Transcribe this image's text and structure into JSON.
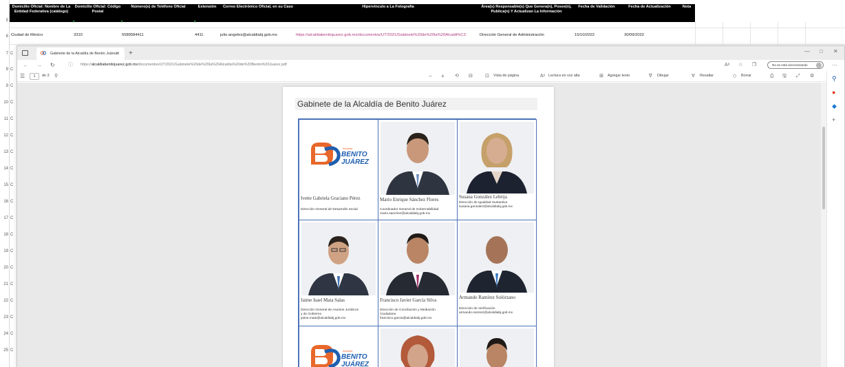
{
  "spreadsheet": {
    "header_cells": [
      "Domicilio Oficial: Nombre de La Entidad Federativa (catálogo)",
      "Domicilio Oficial: Código Postal",
      "Número(s) de Teléfono Oficial",
      "Extensión",
      "Correo Electrónico Oficial, en su Caso",
      "Hipervínculo a La Fotografía",
      "Área(s) Responsable(s) Que Genera(n), Posee(n), Publica(n) Y Actualizan La Información",
      "Fecha de Validación",
      "Fecha de Actualización",
      "Nota"
    ],
    "row6": {
      "entidad": "Ciudad de México",
      "cp": "3310",
      "telefono": "5589584411",
      "extension": "4411",
      "correo": "julio.angeles@alcaldiabj.gob.mx",
      "hipervinculo": "https://alcaldiabenitojuarez.gob.mx/documentos/UT/2021/Gabinete%20de%20la%20Alcaldi%C3",
      "area": "Dirección General de Administración",
      "fecha_validacion": "15/10/2022",
      "fecha_actualizacion": "30/09/2022"
    },
    "row_numbers": [
      "5",
      "6",
      "7",
      "8",
      "9",
      "10",
      "11",
      "12",
      "13",
      "14",
      "15",
      "16",
      "17",
      "18",
      "19",
      "20",
      "21",
      "22",
      "23",
      "24",
      "25"
    ],
    "col_letter": "C"
  },
  "browser": {
    "tab_title": "Gabinete de la Alcaldía de Benito Juárez",
    "tab_close": "×",
    "new_tab": "+",
    "url_prefix": "https://",
    "url_host": "alcaldiabenitojuarez.gob.mx",
    "url_path": "/documentos/UT/2021/Gabinete%20de%20la%20Alcaldia%20de%20Benito%20Juarez.pdf",
    "sync_label": "No se está sincronizando",
    "window_controls": [
      "—",
      "□",
      "✕"
    ]
  },
  "pdf_toolbar": {
    "page_current": "1",
    "page_total": "de 3",
    "page_view": "Vista de página",
    "read_aloud": "Lectura en voz alta",
    "add_text": "Agregar texto",
    "draw": "Dibujar",
    "highlight": "Resaltar",
    "erase": "Borrar"
  },
  "document": {
    "title": "Gabinete de la Alcaldía de Benito Juárez",
    "logo_top": "Alcaldía",
    "logo_line1": "BENITO",
    "logo_line2": "JUÁREZ",
    "people": [
      {
        "name": "Ivette Gabriela Graciano Pérez",
        "lines": [
          "Dirección General de Desarrollo Social"
        ]
      },
      {
        "name": "Mario Enrique Sánchez Flores",
        "lines": [
          "Coordinador General de Gobernabilidad",
          "mario.sanchez@alcaldiabj.gob.mx"
        ]
      },
      {
        "name": "Susana González Lebrija",
        "lines": [
          "Dirección de Igualdad Sustantiva",
          "susana.gonzalez@alcaldiabj.gob.mx"
        ]
      },
      {
        "name": "Jaime Isael Mata Salas",
        "lines": [
          "Dirección General de Asuntos Jurídicos",
          "y de Gobierno",
          "jaime.mata@alcaldiabj.gob.mx"
        ]
      },
      {
        "name": "Francisco Javier García Silva",
        "lines": [
          "Dirección de Conciliación y Mediación",
          "Ciudadana",
          "francisco.garcia@alcaldiabj.gob.mx"
        ]
      },
      {
        "name": "Armando Ramírez Solórzano",
        "lines": [
          "Dirección de Verificación",
          "armando.ramirez@alcaldiabj.gob.mx"
        ]
      }
    ]
  },
  "colors": {
    "sheet_header_bg": "#000000",
    "grid_border": "#4a72b6",
    "link": "#b03a7a",
    "logo_orange": "#e8672a",
    "logo_blue": "#1f5fb0"
  }
}
